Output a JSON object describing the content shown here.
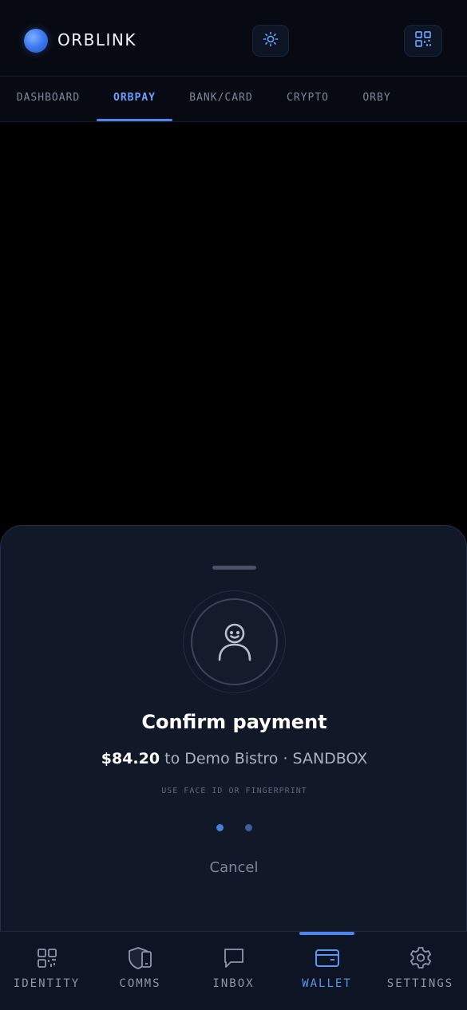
{
  "header": {
    "app_name": "ORBLINK",
    "theme_icon": "sun-icon",
    "qr_icon": "qr-grid-icon"
  },
  "tabs": [
    {
      "label": "DASHBOARD",
      "active": false
    },
    {
      "label": "ORBPAY",
      "active": true
    },
    {
      "label": "BANK/CARD",
      "active": false
    },
    {
      "label": "CRYPTO",
      "active": false
    },
    {
      "label": "ORBY",
      "active": false
    }
  ],
  "sheet": {
    "icon": "face-id-icon",
    "title": "Confirm payment",
    "amount": "$84.20",
    "merchant_text": "to Demo Bistro · SANDBOX",
    "hint": "USE FACE ID OR FINGERPRINT",
    "cancel_label": "Cancel"
  },
  "bottom_nav": [
    {
      "label": "IDENTITY",
      "icon": "qr-grid-icon",
      "active": false
    },
    {
      "label": "COMMS",
      "icon": "shield-phone-icon",
      "active": false
    },
    {
      "label": "INBOX",
      "icon": "chat-bubble-icon",
      "active": false
    },
    {
      "label": "WALLET",
      "icon": "wallet-icon",
      "active": true
    },
    {
      "label": "SETTINGS",
      "icon": "gear-icon",
      "active": false
    }
  ],
  "colors": {
    "accent": "#4b86f0",
    "background": "#000000",
    "sheet": "#111827"
  }
}
